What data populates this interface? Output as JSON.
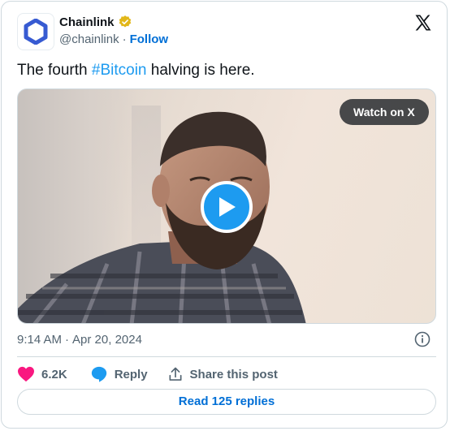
{
  "account": {
    "name": "Chainlink",
    "handle": "@chainlink",
    "separator": "·",
    "follow_label": "Follow",
    "verified": true
  },
  "tweet": {
    "text_before": "The fourth ",
    "hashtag": "#Bitcoin",
    "text_after": " halving is here."
  },
  "media": {
    "watch_label": "Watch on X"
  },
  "meta": {
    "time": "9:14 AM",
    "separator": "·",
    "date": "Apr 20, 2024"
  },
  "actions": {
    "likes": "6.2K",
    "reply_label": "Reply",
    "share_label": "Share this post"
  },
  "footer": {
    "read_replies_label": "Read 125 replies"
  },
  "colors": {
    "brand_blue": "#375bd2",
    "link_blue": "#006fd6",
    "hashtag_blue": "#1d9bf0",
    "like_pink": "#f91880",
    "gold_badge": "#e2b719"
  },
  "icons": {
    "logo": "chainlink-hexagon-icon",
    "verified": "verified-badge-icon",
    "x": "x-logo-icon",
    "play": "play-icon",
    "info": "info-icon",
    "like": "heart-icon",
    "reply": "reply-bubble-icon",
    "share": "share-icon"
  }
}
